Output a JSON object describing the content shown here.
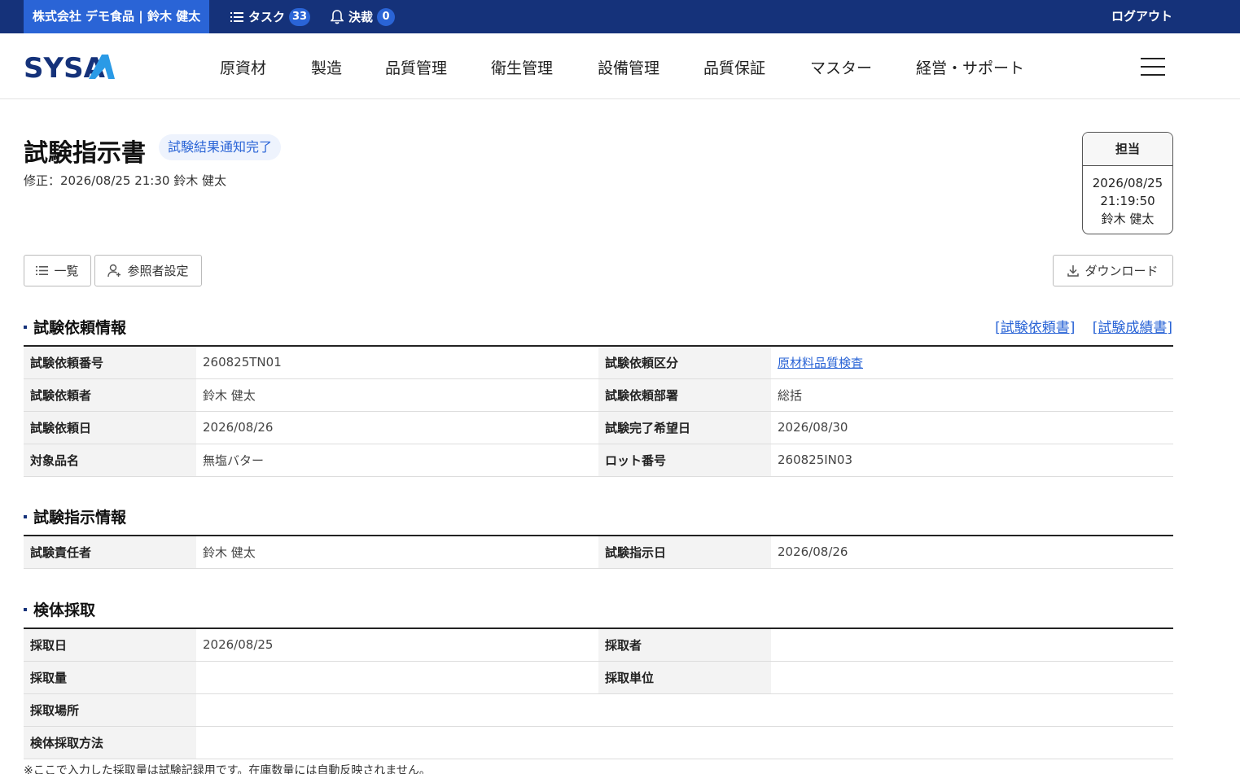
{
  "topbar": {
    "company_user": "株式会社 デモ食品 | 鈴木 健太",
    "tasks_label": "タスク",
    "tasks_count": "33",
    "approvals_label": "決裁",
    "approvals_count": "0",
    "logout": "ログアウト"
  },
  "nav": {
    "logo": "SYSA",
    "items": [
      "原資材",
      "製造",
      "品質管理",
      "衛生管理",
      "設備管理",
      "品質保証",
      "マスター",
      "経営・サポート"
    ]
  },
  "page": {
    "title": "試験指示書",
    "status": "試験結果通知完了",
    "modified": "修正：2026/08/25 21:30 鈴木 健太"
  },
  "stamp": {
    "header": "担当",
    "date": "2026/08/25",
    "time": "21:19:50",
    "name": "鈴木 健太"
  },
  "buttons": {
    "list": "一覧",
    "viewers": "参照者設定",
    "download": "ダウンロード"
  },
  "sections": {
    "request": {
      "title": "試験依頼情報",
      "links": [
        "[試験依頼書]",
        "[試験成績書]"
      ],
      "rows": [
        {
          "l1": "試験依頼番号",
          "v1": "260825TN01",
          "l2": "試験依頼区分",
          "v2": "原材料品質検査"
        },
        {
          "l1": "試験依頼者",
          "v1": "鈴木 健太",
          "l2": "試験依頼部署",
          "v2": "総括"
        },
        {
          "l1": "試験依頼日",
          "v1": "2026/08/26",
          "l2": "試験完了希望日",
          "v2": "2026/08/30"
        },
        {
          "l1": "対象品名",
          "v1": "無塩バター",
          "l2": "ロット番号",
          "v2": "260825IN03"
        }
      ]
    },
    "instruction": {
      "title": "試験指示情報",
      "rows": [
        {
          "l1": "試験責任者",
          "v1": "鈴木 健太",
          "l2": "試験指示日",
          "v2": "2026/08/26"
        }
      ]
    },
    "sampling": {
      "title": "検体採取",
      "rows": [
        {
          "l1": "採取日",
          "v1": "2026/08/25",
          "l2": "採取者",
          "v2": ""
        },
        {
          "l1": "採取量",
          "v1": "",
          "l2": "採取単位",
          "v2": ""
        }
      ],
      "wide_rows": [
        {
          "label": "採取場所",
          "value": ""
        },
        {
          "label": "検体採取方法",
          "value": ""
        }
      ],
      "note": "※ここで入力した採取量は試験記録用です。在庫数量には自動反映されません。"
    }
  },
  "colors": {
    "topbar": "#15327a",
    "accent": "#2a64d6"
  }
}
